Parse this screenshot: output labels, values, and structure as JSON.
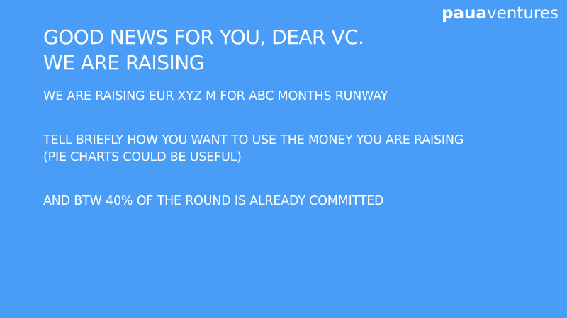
{
  "logo": {
    "part1": "paua",
    "part2": "ventures"
  },
  "title": {
    "line1": "GOOD NEWS FOR YOU, DEAR VC.",
    "line2": "WE ARE RAISING"
  },
  "bullets": [
    {
      "lines": [
        "WE ARE RAISING EUR XYZ M FOR ABC MONTHS RUNWAY"
      ]
    },
    {
      "lines": [
        "TELL BRIEFLY HOW YOU WANT TO USE THE MONEY YOU ARE RAISING",
        "(PIE CHARTS COULD BE USEFUL)"
      ]
    },
    {
      "lines": [
        "AND BTW 40% OF THE ROUND IS ALREADY COMMITTED"
      ]
    }
  ],
  "colors": {
    "background": "#4A9DF7",
    "text": "#ffffff"
  }
}
